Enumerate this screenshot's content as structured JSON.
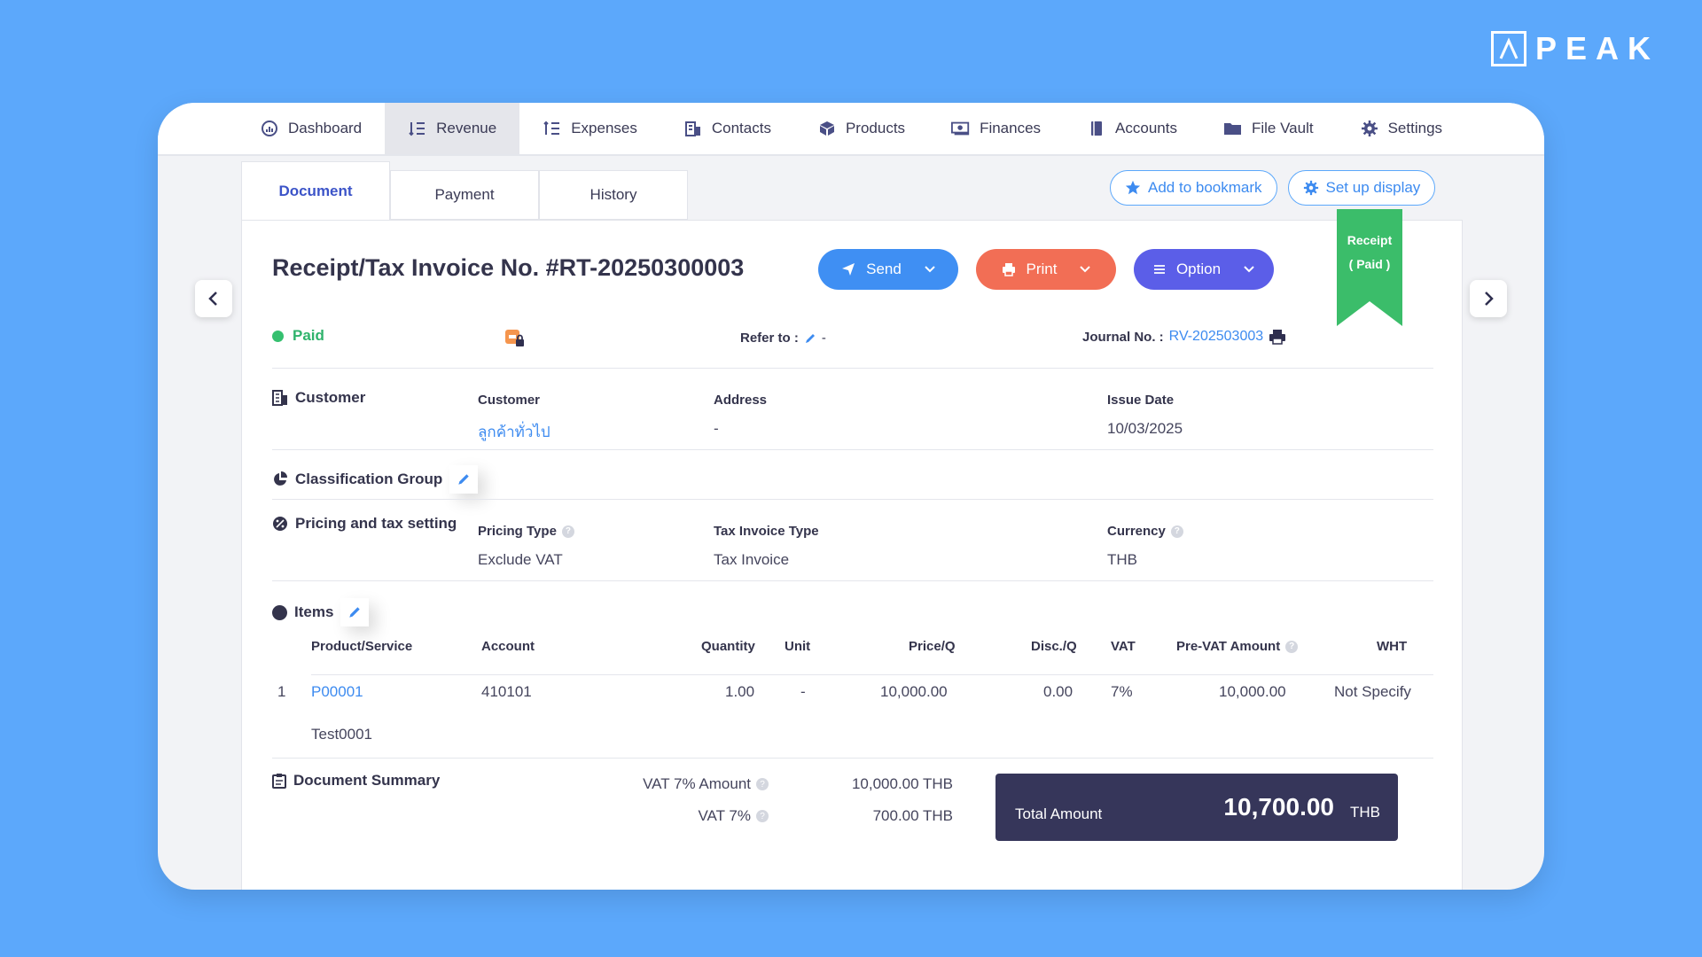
{
  "brand": {
    "name": "PEAK"
  },
  "nav": {
    "items": [
      {
        "label": "Dashboard",
        "icon": "dashboard-icon"
      },
      {
        "label": "Revenue",
        "icon": "revenue-icon",
        "active": true
      },
      {
        "label": "Expenses",
        "icon": "expenses-icon"
      },
      {
        "label": "Contacts",
        "icon": "contacts-icon"
      },
      {
        "label": "Products",
        "icon": "products-icon"
      },
      {
        "label": "Finances",
        "icon": "finances-icon"
      },
      {
        "label": "Accounts",
        "icon": "accounts-icon"
      },
      {
        "label": "File Vault",
        "icon": "folder-icon"
      },
      {
        "label": "Settings",
        "icon": "gear-icon"
      }
    ]
  },
  "tabs": [
    {
      "label": "Document",
      "active": true
    },
    {
      "label": "Payment"
    },
    {
      "label": "History"
    }
  ],
  "top_actions": {
    "bookmark": "Add to bookmark",
    "display": "Set up display"
  },
  "ribbon": {
    "line1": "Receipt",
    "line2": "( Paid )",
    "color": "#3bbd6a"
  },
  "document": {
    "title": "Receipt/Tax Invoice No. #RT-20250300003",
    "status": "Paid",
    "refer_label": "Refer to :",
    "refer_value": "-",
    "journal_label": "Journal No. :",
    "journal_value": "RV-202503003"
  },
  "actions": {
    "send": "Send",
    "print": "Print",
    "option": "Option"
  },
  "customer": {
    "section": "Customer",
    "customer_label": "Customer",
    "customer_value": "ลูกค้าทั่วไป",
    "address_label": "Address",
    "address_value": "-",
    "issue_label": "Issue Date",
    "issue_value": "10/03/2025"
  },
  "classification": {
    "section": "Classification Group"
  },
  "pricing": {
    "section": "Pricing and tax setting",
    "pricing_type_label": "Pricing Type",
    "pricing_type_value": "Exclude VAT",
    "tax_type_label": "Tax Invoice Type",
    "tax_type_value": "Tax Invoice",
    "currency_label": "Currency",
    "currency_value": "THB"
  },
  "items": {
    "section": "Items",
    "headers": {
      "product": "Product/Service",
      "account": "Account",
      "quantity": "Quantity",
      "unit": "Unit",
      "price": "Price/Q",
      "disc": "Disc./Q",
      "vat": "VAT",
      "pre_vat": "Pre-VAT Amount",
      "wht": "WHT"
    },
    "rows": [
      {
        "no": "1",
        "product": "P00001",
        "account": "410101",
        "quantity": "1.00",
        "unit": "-",
        "price": "10,000.00",
        "disc": "0.00",
        "vat": "7%",
        "pre_vat": "10,000.00",
        "wht": "Not Specify",
        "description": "Test0001"
      }
    ]
  },
  "summary": {
    "section": "Document Summary",
    "vat_amount_label": "VAT 7% Amount",
    "vat_amount_value": "10,000.00 THB",
    "vat_label": "VAT 7%",
    "vat_value": "700.00 THB",
    "total_label": "Total Amount",
    "total_value": "10,700.00",
    "total_currency": "THB"
  }
}
